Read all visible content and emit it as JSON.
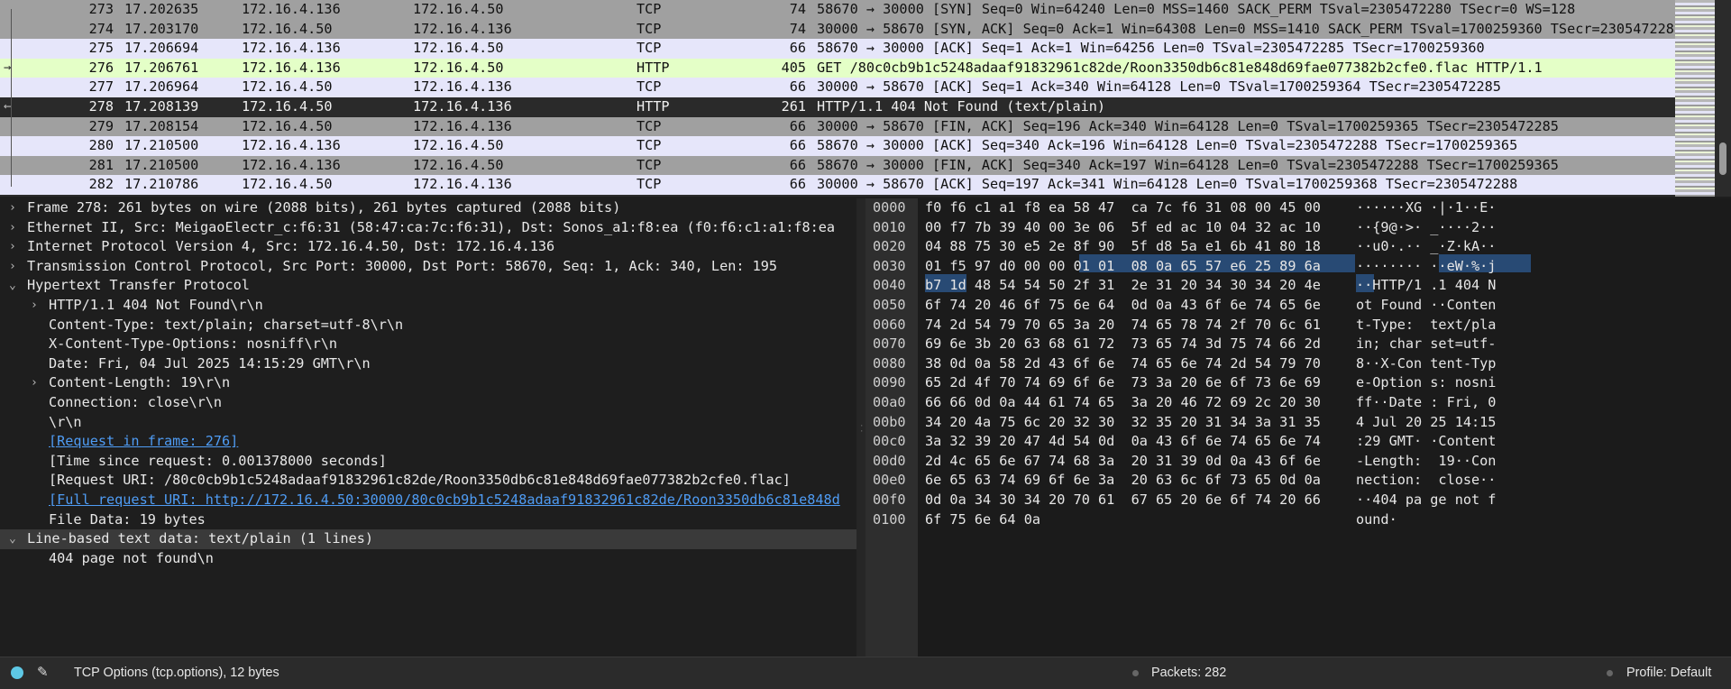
{
  "packets": [
    {
      "no": "273",
      "time": "17.202635",
      "src": "172.16.4.136",
      "dst": "172.16.4.50",
      "proto": "TCP",
      "len": "74",
      "info": "58670 → 30000 [SYN] Seq=0 Win=64240 Len=0 MSS=1460 SACK_PERM TSval=2305472280 TSecr=0 WS=128",
      "bg": "#a0a0a0",
      "rel": ""
    },
    {
      "no": "274",
      "time": "17.203170",
      "src": "172.16.4.50",
      "dst": "172.16.4.136",
      "proto": "TCP",
      "len": "74",
      "info": "30000 → 58670 [SYN, ACK] Seq=0 Ack=1 Win=64308 Len=0 MSS=1410 SACK_PERM TSval=1700259360 TSecr=2305472280",
      "bg": "#a0a0a0",
      "rel": ""
    },
    {
      "no": "275",
      "time": "17.206694",
      "src": "172.16.4.136",
      "dst": "172.16.4.50",
      "proto": "TCP",
      "len": "66",
      "info": "58670 → 30000 [ACK] Seq=1 Ack=1 Win=64256 Len=0 TSval=2305472285 TSecr=1700259360",
      "bg": "#e6e6fa",
      "rel": ""
    },
    {
      "no": "276",
      "time": "17.206761",
      "src": "172.16.4.136",
      "dst": "172.16.4.50",
      "proto": "HTTP",
      "len": "405",
      "info": "GET /80c0cb9b1c5248adaaf91832961c82de/Roon3350db6c81e848d69fae077382b2cfe0.flac HTTP/1.1",
      "bg": "#e4ffc7",
      "rel": "→"
    },
    {
      "no": "277",
      "time": "17.206964",
      "src": "172.16.4.50",
      "dst": "172.16.4.136",
      "proto": "TCP",
      "len": "66",
      "info": "30000 → 58670 [ACK] Seq=1 Ack=340 Win=64128 Len=0 TSval=1700259364 TSecr=2305472285",
      "bg": "#e6e6fa",
      "rel": ""
    },
    {
      "no": "278",
      "time": "17.208139",
      "src": "172.16.4.50",
      "dst": "172.16.4.136",
      "proto": "HTTP",
      "len": "261",
      "info": "HTTP/1.1 404 Not Found  (text/plain)",
      "bg": "#2a2a2a",
      "rel": "←",
      "sel": true
    },
    {
      "no": "279",
      "time": "17.208154",
      "src": "172.16.4.50",
      "dst": "172.16.4.136",
      "proto": "TCP",
      "len": "66",
      "info": "30000 → 58670 [FIN, ACK] Seq=196 Ack=340 Win=64128 Len=0 TSval=1700259365 TSecr=2305472285",
      "bg": "#a0a0a0",
      "rel": ""
    },
    {
      "no": "280",
      "time": "17.210500",
      "src": "172.16.4.136",
      "dst": "172.16.4.50",
      "proto": "TCP",
      "len": "66",
      "info": "58670 → 30000 [ACK] Seq=340 Ack=196 Win=64128 Len=0 TSval=2305472288 TSecr=1700259365",
      "bg": "#e6e6fa",
      "rel": ""
    },
    {
      "no": "281",
      "time": "17.210500",
      "src": "172.16.4.136",
      "dst": "172.16.4.50",
      "proto": "TCP",
      "len": "66",
      "info": "58670 → 30000 [FIN, ACK] Seq=340 Ack=197 Win=64128 Len=0 TSval=2305472288 TSecr=1700259365",
      "bg": "#a0a0a0",
      "rel": ""
    },
    {
      "no": "282",
      "time": "17.210786",
      "src": "172.16.4.50",
      "dst": "172.16.4.136",
      "proto": "TCP",
      "len": "66",
      "info": "30000 → 58670 [ACK] Seq=197 Ack=341 Win=64128 Len=0 TSval=1700259368 TSecr=2305472288",
      "bg": "#e6e6fa",
      "rel": ""
    }
  ],
  "details": [
    {
      "indent": 0,
      "arrow": "›",
      "text": "Frame 278: 261 bytes on wire (2088 bits), 261 bytes captured (2088 bits)"
    },
    {
      "indent": 0,
      "arrow": "›",
      "text": "Ethernet II, Src: MeigaoElectr_c:f6:31 (58:47:ca:7c:f6:31), Dst: Sonos_a1:f8:ea (f0:f6:c1:a1:f8:ea"
    },
    {
      "indent": 0,
      "arrow": "›",
      "text": "Internet Protocol Version 4, Src: 172.16.4.50, Dst: 172.16.4.136"
    },
    {
      "indent": 0,
      "arrow": "›",
      "text": "Transmission Control Protocol, Src Port: 30000, Dst Port: 58670, Seq: 1, Ack: 340, Len: 195"
    },
    {
      "indent": 0,
      "arrow": "⌄",
      "text": "Hypertext Transfer Protocol"
    },
    {
      "indent": 1,
      "arrow": "›",
      "text": "HTTP/1.1 404 Not Found\\r\\n"
    },
    {
      "indent": 1,
      "arrow": "",
      "text": "Content-Type: text/plain; charset=utf-8\\r\\n"
    },
    {
      "indent": 1,
      "arrow": "",
      "text": "X-Content-Type-Options: nosniff\\r\\n"
    },
    {
      "indent": 1,
      "arrow": "",
      "text": "Date: Fri, 04 Jul 2025 14:15:29 GMT\\r\\n"
    },
    {
      "indent": 1,
      "arrow": "›",
      "text": "Content-Length: 19\\r\\n"
    },
    {
      "indent": 1,
      "arrow": "",
      "text": "Connection: close\\r\\n"
    },
    {
      "indent": 1,
      "arrow": "",
      "text": "\\r\\n"
    },
    {
      "indent": 1,
      "arrow": "",
      "text": "[Request in frame: 276]",
      "link": true
    },
    {
      "indent": 1,
      "arrow": "",
      "text": "[Time since request: 0.001378000 seconds]"
    },
    {
      "indent": 1,
      "arrow": "",
      "text": "[Request URI: /80c0cb9b1c5248adaaf91832961c82de/Roon3350db6c81e848d69fae077382b2cfe0.flac]"
    },
    {
      "indent": 1,
      "arrow": "",
      "text": "[Full request URI: http://172.16.4.50:30000/80c0cb9b1c5248adaaf91832961c82de/Roon3350db6c81e848d",
      "link": true
    },
    {
      "indent": 1,
      "arrow": "",
      "text": "File Data: 19 bytes"
    },
    {
      "indent": 0,
      "arrow": "⌄",
      "text": "Line-based text data: text/plain (1 lines)",
      "highlight": true
    },
    {
      "indent": 1,
      "arrow": "",
      "text": "404 page not found\\n"
    }
  ],
  "hex_rows": [
    {
      "off": "0000",
      "hex": "f0 f6 c1 a1 f8 ea 58 47  ca 7c f6 31 08 00 45 00",
      "asc": "······XG ·|·1··E·"
    },
    {
      "off": "0010",
      "hex": "00 f7 7b 39 40 00 3e 06  5f ed ac 10 04 32 ac 10",
      "asc": "··{9@·>· _····2··"
    },
    {
      "off": "0020",
      "hex": "04 88 75 30 e5 2e 8f 90  5f d8 5a e1 6b 41 80 18",
      "asc": "··u0·.·· _·Z·kA··"
    },
    {
      "off": "0030",
      "hex": "01 f5 97 d0 00 00 01 01  08 0a 65 57 e6 25 89 6a",
      "asc": "········ ··eW·%·j"
    },
    {
      "off": "0040",
      "hex": "b7 1d 48 54 54 50 2f 31  2e 31 20 34 30 34 20 4e",
      "asc": "··HTTP/1 .1 404 N"
    },
    {
      "off": "0050",
      "hex": "6f 74 20 46 6f 75 6e 64  0d 0a 43 6f 6e 74 65 6e",
      "asc": "ot Found ··Conten"
    },
    {
      "off": "0060",
      "hex": "74 2d 54 79 70 65 3a 20  74 65 78 74 2f 70 6c 61",
      "asc": "t-Type:  text/pla"
    },
    {
      "off": "0070",
      "hex": "69 6e 3b 20 63 68 61 72  73 65 74 3d 75 74 66 2d",
      "asc": "in; char set=utf-"
    },
    {
      "off": "0080",
      "hex": "38 0d 0a 58 2d 43 6f 6e  74 65 6e 74 2d 54 79 70",
      "asc": "8··X-Con tent-Typ"
    },
    {
      "off": "0090",
      "hex": "65 2d 4f 70 74 69 6f 6e  73 3a 20 6e 6f 73 6e 69",
      "asc": "e-Option s: nosni"
    },
    {
      "off": "00a0",
      "hex": "66 66 0d 0a 44 61 74 65  3a 20 46 72 69 2c 20 30",
      "asc": "ff··Date : Fri, 0"
    },
    {
      "off": "00b0",
      "hex": "34 20 4a 75 6c 20 32 30  32 35 20 31 34 3a 31 35",
      "asc": "4 Jul 20 25 14:15"
    },
    {
      "off": "00c0",
      "hex": "3a 32 39 20 47 4d 54 0d  0a 43 6f 6e 74 65 6e 74",
      "asc": ":29 GMT· ·Content"
    },
    {
      "off": "00d0",
      "hex": "2d 4c 65 6e 67 74 68 3a  20 31 39 0d 0a 43 6f 6e",
      "asc": "-Length:  19··Con"
    },
    {
      "off": "00e0",
      "hex": "6e 65 63 74 69 6f 6e 3a  20 63 6c 6f 73 65 0d 0a",
      "asc": "nection:  close··"
    },
    {
      "off": "00f0",
      "hex": "0d 0a 34 30 34 20 70 61  67 65 20 6e 6f 74 20 66",
      "asc": "··404 pa ge not f"
    },
    {
      "off": "0100",
      "hex": "6f 75 6e 64 0a",
      "asc": "ound·"
    }
  ],
  "status": {
    "field": "TCP Options (tcp.options), 12 bytes",
    "packets": "Packets: 282",
    "profile": "Profile: Default"
  },
  "colors": {
    "selection": "#284a74",
    "link": "#4f9cf4",
    "selected_row": "#2a2a2a"
  }
}
